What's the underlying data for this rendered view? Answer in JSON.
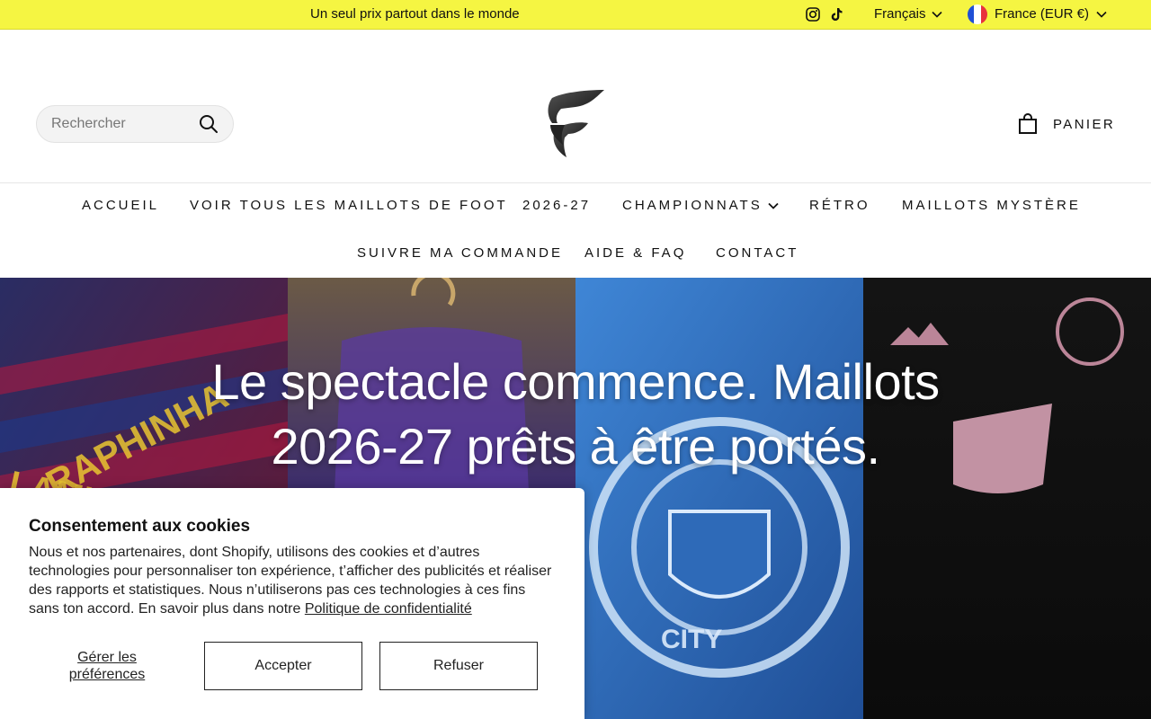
{
  "announcement": {
    "text": "Un seul prix partout dans le monde",
    "language": "Français",
    "country": "France (EUR €)",
    "social_icons": [
      "instagram-icon",
      "tiktok-icon"
    ]
  },
  "header": {
    "search_placeholder": "Rechercher",
    "cart_label": "PANIER"
  },
  "nav": {
    "items": [
      {
        "label": "ACCUEIL"
      },
      {
        "label": "VOIR TOUS LES MAILLOTS DE FOOT"
      },
      {
        "label": "2026-27"
      },
      {
        "label": "CHAMPIONNATS"
      },
      {
        "label": "RÉTRO"
      },
      {
        "label": "MAILLOTS MYSTÈRE"
      },
      {
        "label": "SUIVRE MA COMMANDE"
      },
      {
        "label": "AIDE & FAQ"
      },
      {
        "label": "CONTACT"
      }
    ]
  },
  "hero": {
    "line1": "Le spectacle commence. Maillots",
    "line2": "2026-27 prêts à être portés."
  },
  "cookie": {
    "title": "Consentement aux cookies",
    "body": "Nous et nos partenaires, dont Shopify, utilisons des cookies et d’autres technologies pour personnaliser ton expérience, t’afficher des publicités et réaliser des rapports et statistiques. Nous n’utiliserons pas ces technologies à ces fins sans ton accord. En savoir plus dans notre ",
    "privacy_link": "Politique de confidentialité",
    "manage_line1": "Gérer les",
    "manage_line2": "préférences",
    "accept": "Accepter",
    "refuse": "Refuser"
  },
  "colors": {
    "announcement_bg": "#f5f542",
    "text": "#111111"
  }
}
